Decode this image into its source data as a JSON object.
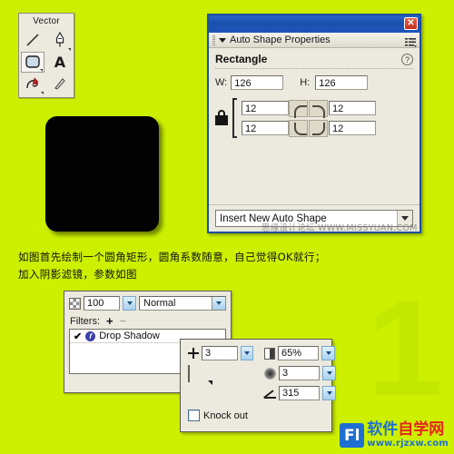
{
  "canvas": {
    "background_color": "#ccf000",
    "shape_color": "#020202"
  },
  "watermark": {
    "big_number": "1",
    "forum_text": "思缘设计论坛 WWW.MISSYUAN.COM",
    "logo_mark": "Fl",
    "logo_cn_blue": "软件",
    "logo_cn_red": "自学网",
    "logo_url": "www.rjzxw.com"
  },
  "vector_panel": {
    "title": "Vector",
    "tools": [
      {
        "name": "line-tool",
        "glyph": "line"
      },
      {
        "name": "pen-tool",
        "glyph": "pen"
      },
      {
        "name": "rounded-rectangle-tool",
        "glyph": "rounded-rect",
        "selected": true
      },
      {
        "name": "text-tool",
        "glyph": "A"
      },
      {
        "name": "freeform-tool",
        "glyph": "freeform"
      },
      {
        "name": "knife-tool",
        "glyph": "knife"
      }
    ]
  },
  "auto_shape": {
    "window_title": "",
    "panel_title": "Auto Shape Properties",
    "shape_name": "Rectangle",
    "help_glyph": "?",
    "close_glyph": "✕",
    "width_label": "W:",
    "width_value": "126",
    "height_label": "H:",
    "height_value": "126",
    "corner_top_left": "12",
    "corner_top_right": "12",
    "corner_bottom_left": "12",
    "corner_bottom_right": "12",
    "insert_button_label": "Insert New Auto Shape"
  },
  "note": {
    "line1": "如图首先绘制一个圆角矩形，圆角系数随意，自己觉得OK就行；",
    "line2": "加入阴影滤镜，参数如图"
  },
  "filters_panel": {
    "opacity_value": "100",
    "blend_mode": "Normal",
    "filters_label": "Filters:",
    "add_glyph": "+",
    "remove_glyph": "−",
    "filter_items": [
      {
        "enabled_glyph": "✔",
        "badge": "f",
        "label": "Drop Shadow"
      }
    ]
  },
  "drop_shadow": {
    "distance_value": "3",
    "color_value": "#000000",
    "opacity_value": "65%",
    "softness_value": "3",
    "angle_value": "315",
    "knock_out_label": "Knock out",
    "knock_out_checked": false
  }
}
